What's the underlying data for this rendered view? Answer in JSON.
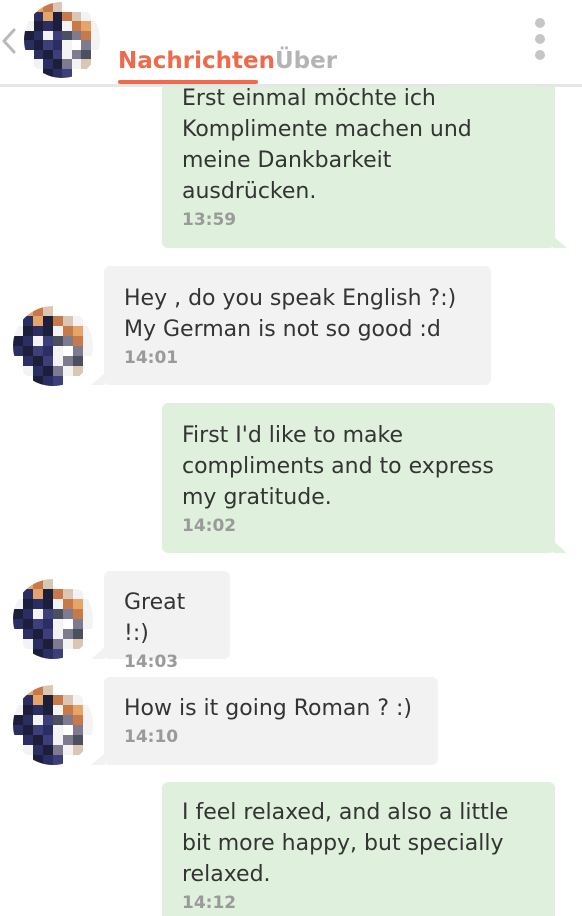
{
  "header": {
    "back_icon": "chevron-left-icon",
    "tabs": [
      {
        "label": "Nachrichten",
        "active": true
      },
      {
        "label": "Über",
        "active": false
      }
    ],
    "menu_icon": "more-vertical-icon"
  },
  "colors": {
    "accent": "#ef6a4a",
    "outgoing_bubble": "#dff1dc",
    "incoming_bubble": "#f2f2f2",
    "text": "#343434",
    "timestamp": "#9a9a9a"
  },
  "messages": [
    {
      "direction": "outgoing",
      "text": "Erst einmal möchte ich\nKomplimente machen und\nmeine Dankbarkeit\nausdrücken.",
      "time": "13:59"
    },
    {
      "direction": "incoming",
      "text": "Hey , do you speak English ?:)\nMy German is not so good :d",
      "time": "14:01"
    },
    {
      "direction": "outgoing",
      "text": "First I'd like to make\ncompliments and to express\nmy gratitude.",
      "time": "14:02"
    },
    {
      "direction": "incoming",
      "text": "Great !:)",
      "time": "14:03"
    },
    {
      "direction": "incoming",
      "text": "How is it going Roman ? :)",
      "time": "14:10"
    },
    {
      "direction": "outgoing",
      "text": "I feel relaxed, and also a little\nbit more happy, but specially\nrelaxed.",
      "time": "14:12"
    }
  ]
}
